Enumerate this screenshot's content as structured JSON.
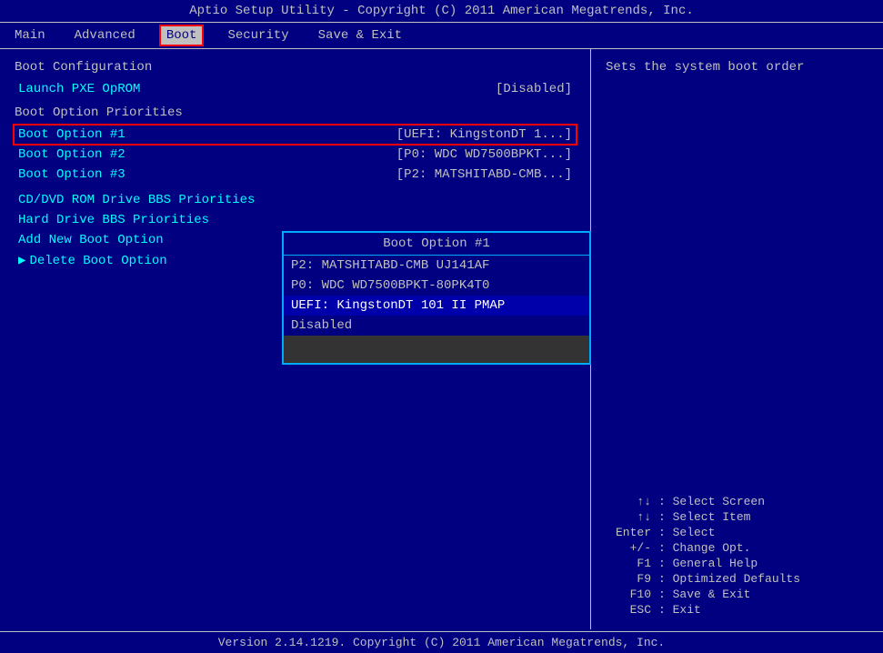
{
  "titleBar": {
    "text": "Aptio Setup Utility - Copyright (C) 2011 American Megatrends, Inc."
  },
  "menuBar": {
    "items": [
      {
        "label": "Main",
        "active": false
      },
      {
        "label": "Advanced",
        "active": false
      },
      {
        "label": "Boot",
        "active": true
      },
      {
        "label": "Security",
        "active": false
      },
      {
        "label": "Save & Exit",
        "active": false
      }
    ]
  },
  "leftPanel": {
    "sectionTitle1": "Boot Configuration",
    "launchPXE": {
      "label": "Launch PXE OpROM",
      "value": "[Disabled]"
    },
    "sectionTitle2": "Boot Option Priorities",
    "bootOptions": [
      {
        "label": "Boot Option #1",
        "value": "[UEFI: KingstonDT 1...]",
        "selected": true
      },
      {
        "label": "Boot Option #2",
        "value": "[P0: WDC WD7500BPKT...]"
      },
      {
        "label": "Boot Option #3",
        "value": "[P2: MATSHITABD-CMB...]"
      }
    ],
    "menuLinks": [
      {
        "label": "CD/DVD ROM Drive BBS Priorities",
        "arrow": false
      },
      {
        "label": "Hard Drive BBS Priorities",
        "arrow": false
      },
      {
        "label": "Add New Boot Option",
        "arrow": false
      },
      {
        "label": "Delete Boot Option",
        "arrow": true
      }
    ]
  },
  "dropdown": {
    "title": "Boot Option #1",
    "options": [
      {
        "label": "P2: MATSHITABD-CMB UJ141AF",
        "highlighted": false
      },
      {
        "label": "P0: WDC WD7500BPKT-80PK4T0",
        "highlighted": false
      },
      {
        "label": "UEFI: KingstonDT 101 II PMAP",
        "highlighted": true
      },
      {
        "label": "Disabled",
        "highlighted": false
      }
    ]
  },
  "rightPanel": {
    "helpText": "Sets the system boot order",
    "shortcuts": [
      {
        "key": "↑↓",
        "desc": ": Select Screen"
      },
      {
        "key": "↑↓",
        "desc": ": Select Item"
      },
      {
        "key": "Enter",
        "desc": ": Select"
      },
      {
        "key": "+/-",
        "desc": ": Change Opt."
      },
      {
        "key": "F1",
        "desc": ": General Help"
      },
      {
        "key": "F9",
        "desc": ": Optimized Defaults"
      },
      {
        "key": "F10",
        "desc": ": Save & Exit"
      },
      {
        "key": "ESC",
        "desc": ": Exit"
      }
    ]
  },
  "footer": {
    "text": "Version 2.14.1219. Copyright (C) 2011 American Megatrends, Inc."
  }
}
